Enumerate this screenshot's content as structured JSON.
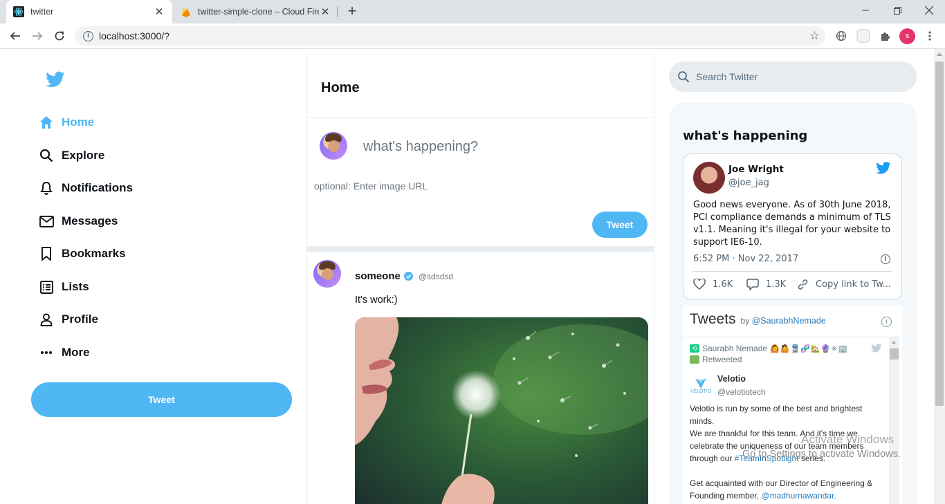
{
  "browser": {
    "tabs": [
      {
        "title": "twitter",
        "active": true
      },
      {
        "title": "twitter-simple-clone – Cloud Fire",
        "active": false
      }
    ],
    "new_tab": "+",
    "url": "localhost:3000/?",
    "profile_initial": "s"
  },
  "sidebar": {
    "items": [
      {
        "label": "Home",
        "icon": "home-icon",
        "active": true
      },
      {
        "label": "Explore",
        "icon": "search-icon"
      },
      {
        "label": "Notifications",
        "icon": "bell-icon"
      },
      {
        "label": "Messages",
        "icon": "mail-icon"
      },
      {
        "label": "Bookmarks",
        "icon": "bookmark-icon"
      },
      {
        "label": "Lists",
        "icon": "list-icon"
      },
      {
        "label": "Profile",
        "icon": "person-icon"
      },
      {
        "label": "More",
        "icon": "more-icon"
      }
    ],
    "tweet_button": "Tweet",
    "brand_color": "#50b7f5"
  },
  "feed": {
    "title": "Home",
    "composer": {
      "placeholder": "what's happening?",
      "image_placeholder": "optional: Enter image URL",
      "tweet_button": "Tweet"
    },
    "post": {
      "display_name": "someone",
      "verified": true,
      "username": "@sdsdsd",
      "text": "It's work:)"
    }
  },
  "widgets": {
    "search_placeholder": "Search Twitter",
    "title": "what's happening",
    "embed": {
      "name": "Joe Wright",
      "handle": "@joe_jag",
      "text": "Good news everyone. As of 30th June 2018, PCI compliance demands a minimum of TLS v1.1. Meaning it's illegal for your website to support IE6-10.",
      "time": "6:52 PM · Nov 22, 2017",
      "likes": "1.6K",
      "replies": "1.3K",
      "copy_link": "Copy link to Tw..."
    },
    "timeline": {
      "title": "Tweets",
      "by": "by",
      "by_handle": "@SaurabhNemade",
      "retweeter": "Saurabh Nemade",
      "retweeter_emoji": "🙆🤷🚆🧬🏡🔮✳🏢",
      "retweeted_label": "Retweeted",
      "author_name": "Velotio",
      "author_handle": "@velotiotech",
      "logo_text": "VELOTIO",
      "text_1": "Velotio is run by some of the best and brightest minds.",
      "text_2": "We are thankful for this team. And it's time we celebrate the uniqueness of our team members through our",
      "text_2_tag": "#TeamInSpotlight",
      "text_2_end": "series.",
      "text_3": "Get acquainted with our Director of Engineering & Founding member,",
      "text_3_link": "@madhurnawandar."
    }
  },
  "watermark": {
    "line1": "Activate Windows",
    "line2": "Go to Settings to activate Windows."
  }
}
